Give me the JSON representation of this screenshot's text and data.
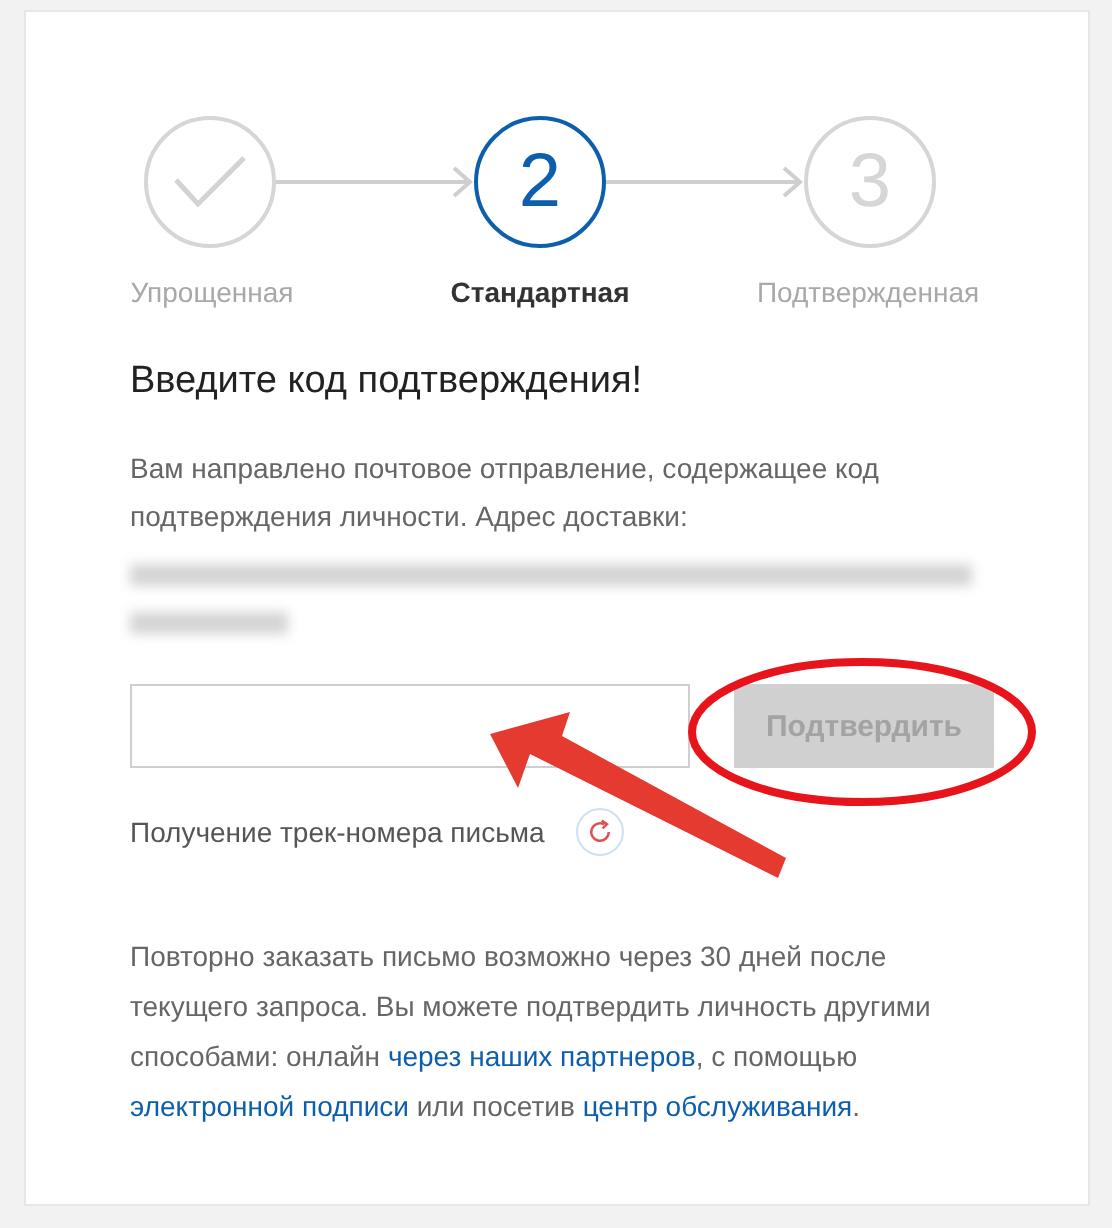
{
  "steps": [
    {
      "kind": "done",
      "label": "Упрощенная",
      "selected": false
    },
    {
      "kind": "number",
      "number": "2",
      "label": "Стандартная",
      "selected": true
    },
    {
      "kind": "number",
      "number": "3",
      "label": "Подтвержденная",
      "selected": false
    }
  ],
  "heading": "Введите код подтверждения!",
  "message": "Вам направлено почтовое отправление, содержащее код подтверждения личности. Адрес доставки:",
  "confirm_button": {
    "label": "Подтвердить",
    "disabled": true
  },
  "tracking": {
    "label": "Получение трек-номера письма"
  },
  "info": [
    {
      "kind": "text",
      "text": "Повторно заказать письмо возможно через 30 дней после текущего запроса. Вы можете подтвердить личность другими способами: онлайн "
    },
    {
      "kind": "link",
      "text": "через наших партнеров"
    },
    {
      "kind": "text",
      "text": ", с помощью "
    },
    {
      "kind": "link",
      "text": "электронной подписи"
    },
    {
      "kind": "text",
      "text": " или посетив "
    },
    {
      "kind": "link",
      "text": "центр обслуживания"
    },
    {
      "kind": "text",
      "text": "."
    }
  ]
}
